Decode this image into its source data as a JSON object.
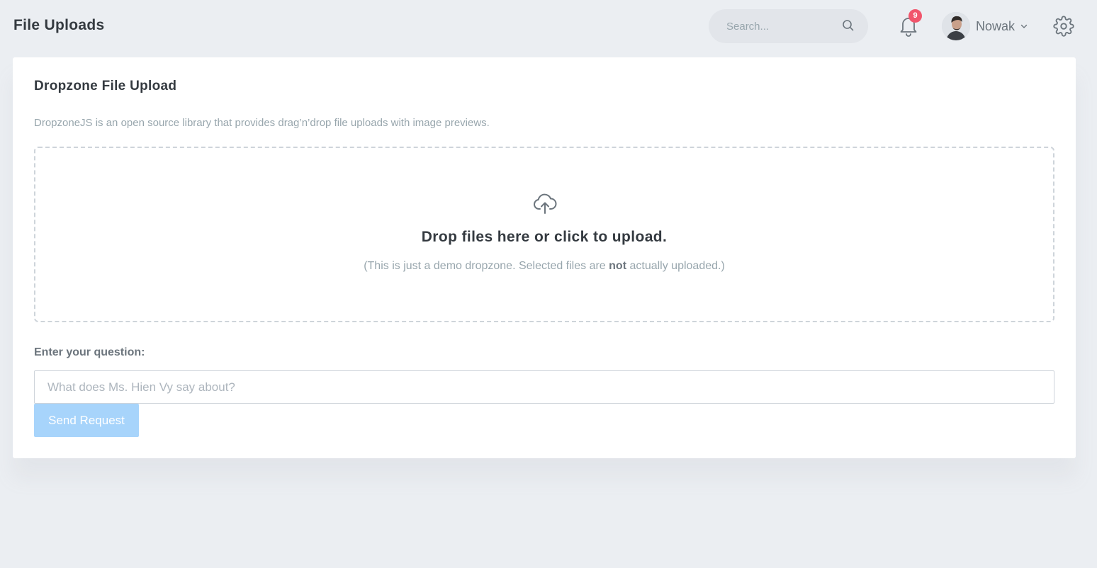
{
  "header": {
    "title": "File Uploads",
    "search_placeholder": "Search...",
    "notifications_count": "9",
    "user_name": "Nowak"
  },
  "card": {
    "title": "Dropzone File Upload",
    "subtitle": "DropzoneJS is an open source library that provides drag’n’drop file uploads with image previews.",
    "dropzone": {
      "title": "Drop files here or click to upload.",
      "note_prefix": "(This is just a demo dropzone. Selected files are ",
      "note_bold": "not",
      "note_suffix": " actually uploaded.)"
    },
    "question_label": "Enter your question:",
    "question_placeholder": "What does Ms. Hien Vy say about?",
    "question_value": "",
    "send_label": "Send Request"
  },
  "icons": {
    "search": "search-icon",
    "bell": "bell-icon",
    "chevron": "chevron-down-icon",
    "gear": "gear-icon",
    "cloud_upload": "cloud-upload-icon"
  },
  "colors": {
    "background": "#ebeef2",
    "card": "#ffffff",
    "badge": "#f1556c",
    "button": "#a7d4fb",
    "muted_text": "#98a6ad",
    "heading_text": "#343a40"
  }
}
